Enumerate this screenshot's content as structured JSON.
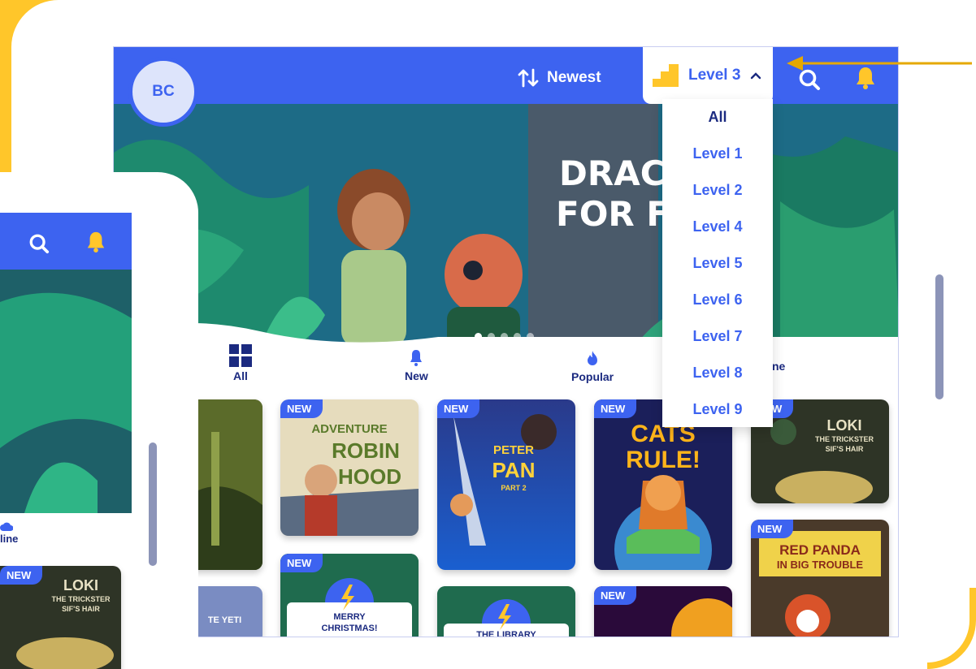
{
  "header": {
    "avatar_initials": "BC",
    "sort_label": "Newest",
    "level_selected": "Level 3"
  },
  "level_menu": {
    "options": [
      "All",
      "Level 1",
      "Level 2",
      "Level 4",
      "Level 5",
      "Level 6",
      "Level 7",
      "Level 8",
      "Level 9"
    ]
  },
  "hero": {
    "title_partial": "DRAC\nFOR F",
    "slides_total": 5,
    "slide_active": 1
  },
  "tabs": [
    {
      "label": "All",
      "icon": "grid-icon"
    },
    {
      "label": "New",
      "icon": "bell-icon"
    },
    {
      "label": "Popular",
      "icon": "fire-icon"
    },
    {
      "label": "ne",
      "icon": "cloud-icon"
    }
  ],
  "books": {
    "badge": "NEW",
    "robin_hood": {
      "l1": "ADVENTURE",
      "l2": "ROBIN",
      "l3": "HOOD"
    },
    "peter_pan": {
      "l1": "PETER",
      "l2": "PAN",
      "l3": "PART 2"
    },
    "cats_rule": {
      "l1": "CATS",
      "l2": "RULE!"
    },
    "loki": {
      "l1": "LOKI",
      "l2": "THE TRICKSTER",
      "l3": "SIF'S HAIR"
    },
    "red_panda": {
      "l1": "RED PANDA",
      "l2": "IN BIG TROUBLE"
    },
    "christmas": {
      "l1": "MERRY",
      "l2": "CHRISTMAS!"
    },
    "library": {
      "l1": "THE LIBRARY"
    },
    "yeti": {
      "l1": "TE YETI"
    }
  },
  "small_phone": {
    "tab_label": "line",
    "badge": "NEW",
    "loki": {
      "l1": "LOKI",
      "l2": "THE TRICKSTER",
      "l3": "SIF'S HAIR"
    }
  },
  "colors": {
    "brand_blue": "#3d63f0",
    "background_yellow": "#ffc62a",
    "navy": "#1b2a80"
  }
}
